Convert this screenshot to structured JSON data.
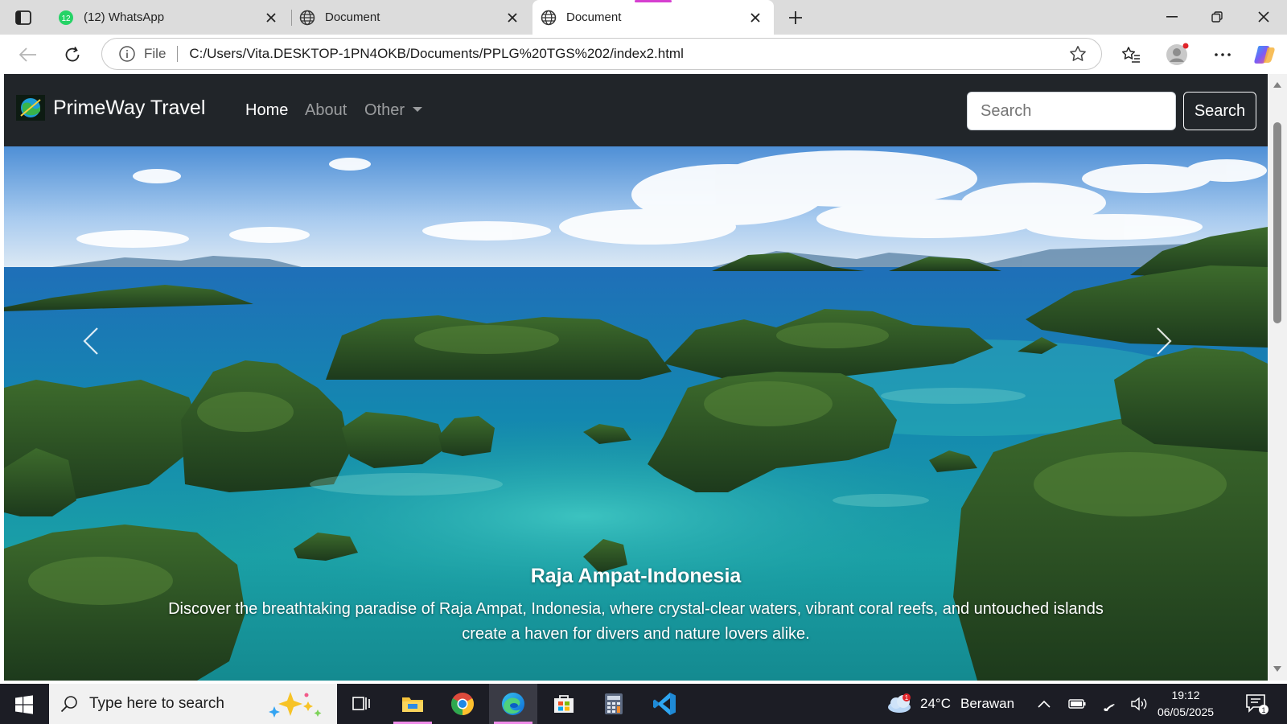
{
  "browser": {
    "tabs": [
      {
        "title": "(12) WhatsApp",
        "badge": "12",
        "active": false
      },
      {
        "title": "Document",
        "active": false
      },
      {
        "title": "Document",
        "active": true
      }
    ],
    "address": {
      "scheme": "File",
      "url": "C:/Users/Vita.DESKTOP-1PN4OKB/Documents/PPLG%20TGS%202/index2.html"
    }
  },
  "page": {
    "brand": {
      "name": "PrimeWay Travel"
    },
    "nav": {
      "home": "Home",
      "about": "About",
      "other": "Other"
    },
    "search": {
      "placeholder": "Search",
      "button": "Search"
    },
    "carousel": {
      "title": "Raja Ampat-Indonesia",
      "text": "Discover the breathtaking paradise of Raja Ampat, Indonesia, where crystal-clear waters, vibrant coral reefs, and untouched islands create a haven for divers and nature lovers alike."
    }
  },
  "taskbar": {
    "search_placeholder": "Type here to search",
    "weather": {
      "temp": "24°C",
      "condition": "Berawan",
      "alert_count": "1"
    },
    "clock": {
      "time": "19:12",
      "date": "06/05/2025"
    },
    "notifications": "1"
  },
  "colors": {
    "navbar": "#212529",
    "accent_tab": "#d63fd0",
    "taskbar": "#1c1d25"
  }
}
